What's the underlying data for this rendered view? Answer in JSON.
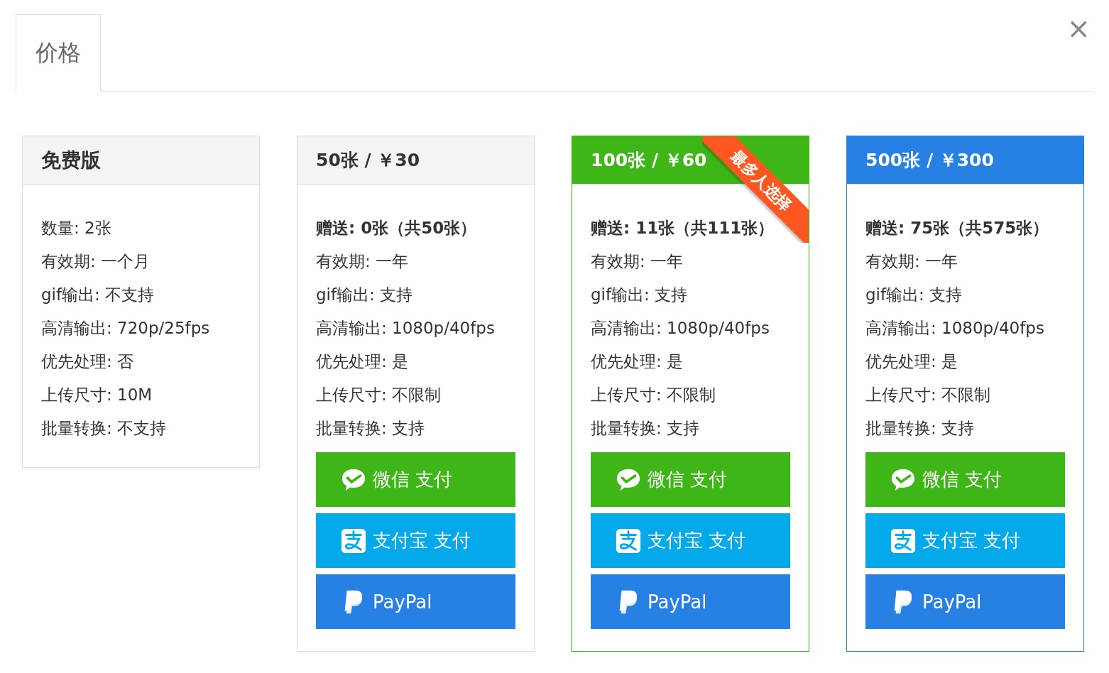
{
  "tabs": [
    {
      "label": "价格",
      "selected": true
    }
  ],
  "close": "×",
  "plans": [
    {
      "title": "免费版",
      "kind": "free",
      "color": "#f4f4f4",
      "features": [
        {
          "text": "数量: 2张",
          "bold": false
        },
        {
          "text": "有效期: 一个月",
          "bold": false
        },
        {
          "text": "gif输出: 不支持",
          "bold": false
        },
        {
          "text": "高清输出: 720p/25fps",
          "bold": false
        },
        {
          "text": "优先处理: 否",
          "bold": false
        },
        {
          "text": "上传尺寸: 10M",
          "bold": false
        },
        {
          "text": "批量转换: 不支持",
          "bold": false
        }
      ]
    },
    {
      "title": "50张 / ￥30",
      "kind": "paid",
      "color": "#f4f4f4",
      "features": [
        {
          "text": "赠送: 0张（共50张）",
          "bold": true
        },
        {
          "text": "有效期: 一年",
          "bold": false
        },
        {
          "text": "gif输出: 支持",
          "bold": false
        },
        {
          "text": "高清输出: 1080p/40fps",
          "bold": false
        },
        {
          "text": "优先处理: 是",
          "bold": false
        },
        {
          "text": "上传尺寸: 不限制",
          "bold": false
        },
        {
          "text": "批量转换: 支持",
          "bold": false
        }
      ],
      "payments": [
        {
          "kind": "wechat",
          "label": "微信 支付"
        },
        {
          "kind": "alipay",
          "label": "支付宝 支付"
        },
        {
          "kind": "paypal",
          "label": "PayPal"
        }
      ]
    },
    {
      "title": "100张 / ￥60",
      "kind": "paid",
      "color": "#3fb618",
      "ribbon": "最多人选择",
      "features": [
        {
          "text": "赠送: 11张（共111张）",
          "bold": true
        },
        {
          "text": "有效期: 一年",
          "bold": false
        },
        {
          "text": "gif输出: 支持",
          "bold": false
        },
        {
          "text": "高清输出: 1080p/40fps",
          "bold": false
        },
        {
          "text": "优先处理: 是",
          "bold": false
        },
        {
          "text": "上传尺寸: 不限制",
          "bold": false
        },
        {
          "text": "批量转换: 支持",
          "bold": false
        }
      ],
      "payments": [
        {
          "kind": "wechat",
          "label": "微信 支付"
        },
        {
          "kind": "alipay",
          "label": "支付宝 支付"
        },
        {
          "kind": "paypal",
          "label": "PayPal"
        }
      ]
    },
    {
      "title": "500张 / ￥300",
      "kind": "paid",
      "color": "#2780e3",
      "features": [
        {
          "text": "赠送: 75张（共575张）",
          "bold": true
        },
        {
          "text": "有效期: 一年",
          "bold": false
        },
        {
          "text": "gif输出: 支持",
          "bold": false
        },
        {
          "text": "高清输出: 1080p/40fps",
          "bold": false
        },
        {
          "text": "优先处理: 是",
          "bold": false
        },
        {
          "text": "上传尺寸: 不限制",
          "bold": false
        },
        {
          "text": "批量转换: 支持",
          "bold": false
        }
      ],
      "payments": [
        {
          "kind": "wechat",
          "label": "微信 支付"
        },
        {
          "kind": "alipay",
          "label": "支付宝 支付"
        },
        {
          "kind": "paypal",
          "label": "PayPal"
        }
      ]
    }
  ]
}
